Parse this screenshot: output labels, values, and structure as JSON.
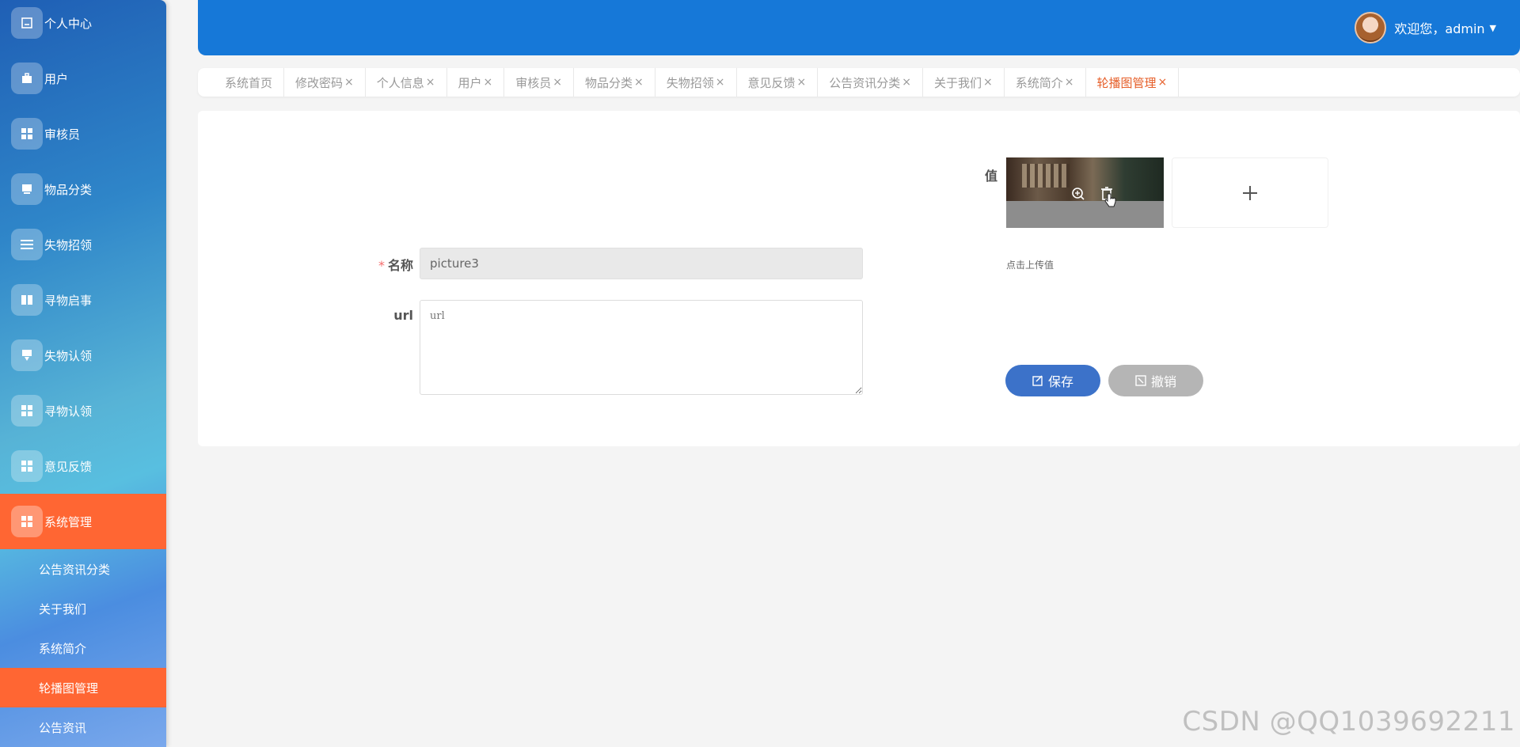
{
  "sidebar": {
    "items": [
      {
        "label": "个人中心",
        "icon": "profile-icon"
      },
      {
        "label": "用户",
        "icon": "briefcase-icon"
      },
      {
        "label": "审核员",
        "icon": "grid-icon"
      },
      {
        "label": "物品分类",
        "icon": "box-icon"
      },
      {
        "label": "失物招领",
        "icon": "list-icon"
      },
      {
        "label": "寻物启事",
        "icon": "book-icon"
      },
      {
        "label": "失物认领",
        "icon": "tag-icon"
      },
      {
        "label": "寻物认领",
        "icon": "grid-icon"
      },
      {
        "label": "意见反馈",
        "icon": "grid-icon"
      },
      {
        "label": "系统管理",
        "icon": "grid-icon"
      }
    ],
    "sub_items": [
      {
        "label": "公告资讯分类"
      },
      {
        "label": "关于我们"
      },
      {
        "label": "系统简介"
      },
      {
        "label": "轮播图管理"
      },
      {
        "label": "公告资讯"
      }
    ]
  },
  "header": {
    "welcome": "欢迎您，admin",
    "accent": "#1678d8"
  },
  "tabs": [
    {
      "label": "系统首页",
      "closable": false
    },
    {
      "label": "修改密码",
      "closable": true
    },
    {
      "label": "个人信息",
      "closable": true
    },
    {
      "label": "用户",
      "closable": true
    },
    {
      "label": "审核员",
      "closable": true
    },
    {
      "label": "物品分类",
      "closable": true
    },
    {
      "label": "失物招领",
      "closable": true
    },
    {
      "label": "意见反馈",
      "closable": true
    },
    {
      "label": "公告资讯分类",
      "closable": true
    },
    {
      "label": "关于我们",
      "closable": true
    },
    {
      "label": "系统简介",
      "closable": true
    },
    {
      "label": "轮播图管理",
      "closable": true
    }
  ],
  "form": {
    "name_label": "名称",
    "name_required": "*",
    "name_value": "picture3",
    "url_label": "url",
    "url_placeholder": "url",
    "value_label": "值",
    "upload_hint": "点击上传值",
    "save_label": "保存",
    "cancel_label": "撤销"
  },
  "colors": {
    "active_menu": "#ff6633",
    "save_button": "#3c72c9",
    "cancel_button": "#b5b5b5",
    "active_tab": "#e65f2a"
  },
  "watermark": "CSDN @QQ1039692211"
}
